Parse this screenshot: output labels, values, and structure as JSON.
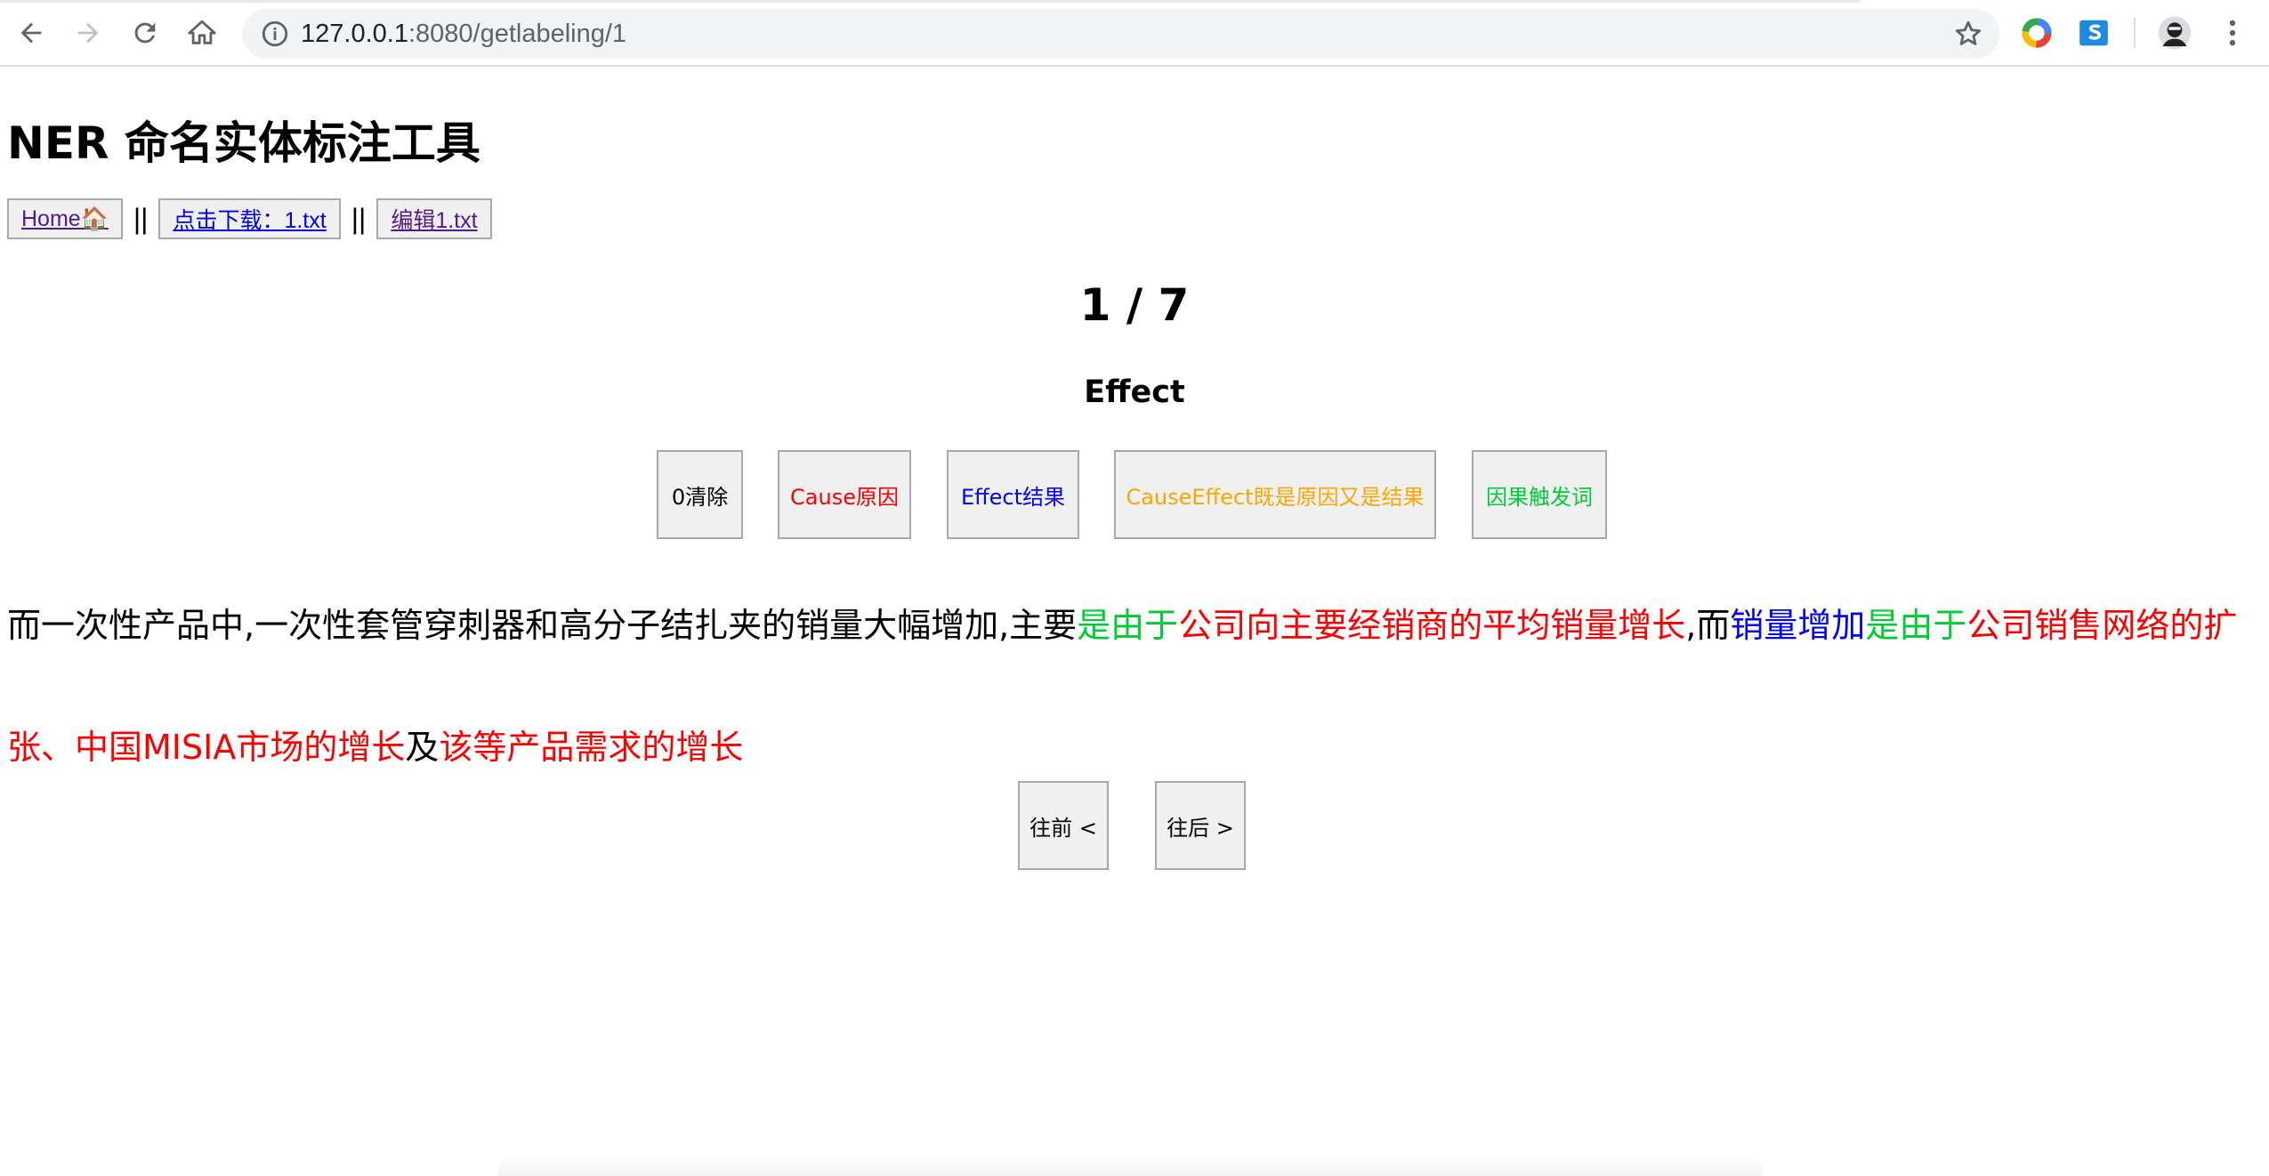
{
  "browser": {
    "url_host": "127.0.0.1",
    "url_rest": ":8080/getlabeling/1"
  },
  "page": {
    "title": "NER 命名实体标注工具",
    "nav": {
      "home": "Home🏠",
      "separator": "||",
      "download": "点击下载：1.txt",
      "edit": "编辑1.txt"
    },
    "counter": "1 / 7",
    "current_label": "Effect",
    "label_buttons": [
      {
        "text": "0清除",
        "color": "#000000"
      },
      {
        "text": "Cause原因",
        "color": "#ff0000"
      },
      {
        "text": "Effect结果",
        "color": "#0000ff"
      },
      {
        "text": "CauseEffect既是原因又是结果",
        "color": "#ffa500"
      },
      {
        "text": "因果触发词",
        "color": "#00cc33"
      }
    ],
    "segments": [
      {
        "text": "而一次性产品中,一次性套管穿刺器和高分子结扎夹的销量大幅增加,主要",
        "color": "#000000"
      },
      {
        "text": "是由于",
        "color": "#00cc33"
      },
      {
        "text": "公司向主要经销商的平均销量增长",
        "color": "#ff0000"
      },
      {
        "text": ",而",
        "color": "#000000"
      },
      {
        "text": "销量增加",
        "color": "#0000ff"
      },
      {
        "text": "是由于",
        "color": "#00cc33"
      },
      {
        "text": "公司销售网络的扩张、中国MISIA市场的增长",
        "color": "#ff0000"
      },
      {
        "text": "及",
        "color": "#000000"
      },
      {
        "text": "该等产品需求的增长",
        "color": "#ff0000"
      }
    ],
    "pager": {
      "prev": "往前 <",
      "next": "往后 >"
    }
  }
}
